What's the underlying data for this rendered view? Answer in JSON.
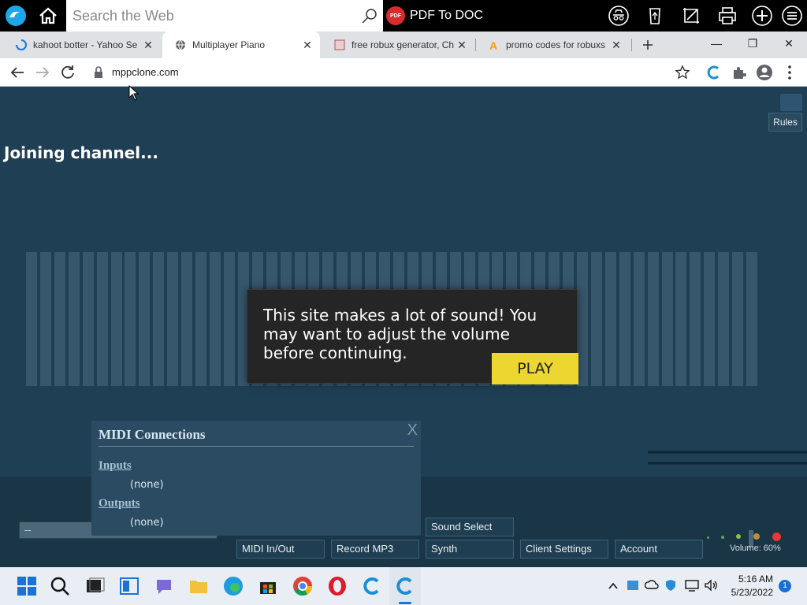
{
  "topbar": {
    "search_placeholder": "Search the Web",
    "pdf_label": "PDF To DOC",
    "pdf_icon_text": "PDF"
  },
  "tabs": [
    {
      "title": "kahoot botter - Yahoo Se",
      "icon": "loading-spinner-icon"
    },
    {
      "title": "Multiplayer Piano",
      "icon": "globe-icon"
    },
    {
      "title": "free robux generator, Ch",
      "icon": "site-favicon-icon"
    },
    {
      "title": "promo codes for robuxs",
      "icon": "amazon-favicon-icon"
    }
  ],
  "address": {
    "url": "mppclone.com"
  },
  "page": {
    "rules_label": "Rules",
    "modal_text": "This site makes a lot of sound! You may want to adjust the volume before continuing.",
    "play_label": "PLAY"
  },
  "midi": {
    "title": "MIDI Connections",
    "close_label": "X",
    "inputs_label": "Inputs",
    "inputs_value": "(none)",
    "outputs_label": "Outputs",
    "outputs_value": "(none)"
  },
  "bottom": {
    "chat_value": "--",
    "status": "Joining channel...",
    "buttons": {
      "sound_select": "Sound Select",
      "midi_inout": "MIDI In/Out",
      "record_mp3": "Record MP3",
      "synth": "Synth",
      "client_settings": "Client Settings",
      "account": "Account"
    },
    "volume": "Volume: 60%",
    "volume_percent": 60
  },
  "taskbar": {
    "time": "5:16 AM",
    "date": "5/23/2022",
    "badge": "1"
  },
  "colors": {
    "page_bg": "#1f3f55",
    "play_yellow": "#ecd730",
    "modal_bg": "#252525"
  }
}
